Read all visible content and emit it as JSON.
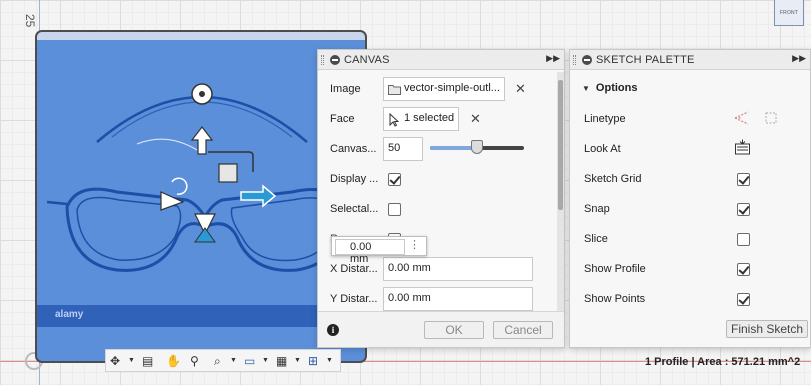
{
  "axis_label": "25",
  "viewcube_label": "FRONT",
  "canvas_image": {
    "watermark": "alamy",
    "background_color": "#5b8fd9"
  },
  "canvas_panel": {
    "title": "CANVAS",
    "rows": {
      "image_label": "Image",
      "image_value": "vector-simple-outl...",
      "face_label": "Face",
      "face_value": "1 selected",
      "opacity_label": "Canvas...",
      "opacity_value": "50",
      "opacity_fraction": 0.5,
      "display_label": "Display ...",
      "display_checked": true,
      "selectable_label": "Selectal...",
      "selectable_checked": false,
      "render_label": "Re...",
      "render_checked": false,
      "x_label": "X Distar...",
      "x_value": "0.00 mm",
      "y_label": "Y Distar...",
      "y_value": "0.00 mm"
    },
    "ok_label": "OK",
    "cancel_label": "Cancel"
  },
  "dimension_popup": {
    "value": "0.00 mm"
  },
  "sketch_palette": {
    "title": "SKETCH PALETTE",
    "options_title": "Options",
    "linetype_label": "Linetype",
    "look_at_label": "Look At",
    "items": [
      {
        "label": "Sketch Grid",
        "checked": true
      },
      {
        "label": "Snap",
        "checked": true
      },
      {
        "label": "Slice",
        "checked": false
      },
      {
        "label": "Show Profile",
        "checked": true
      },
      {
        "label": "Show Points",
        "checked": true
      }
    ],
    "finish_label": "Finish Sketch"
  },
  "status": {
    "text": "1 Profile | Area : 571.21 mm^2"
  },
  "accent_color": "#2f6fd6"
}
